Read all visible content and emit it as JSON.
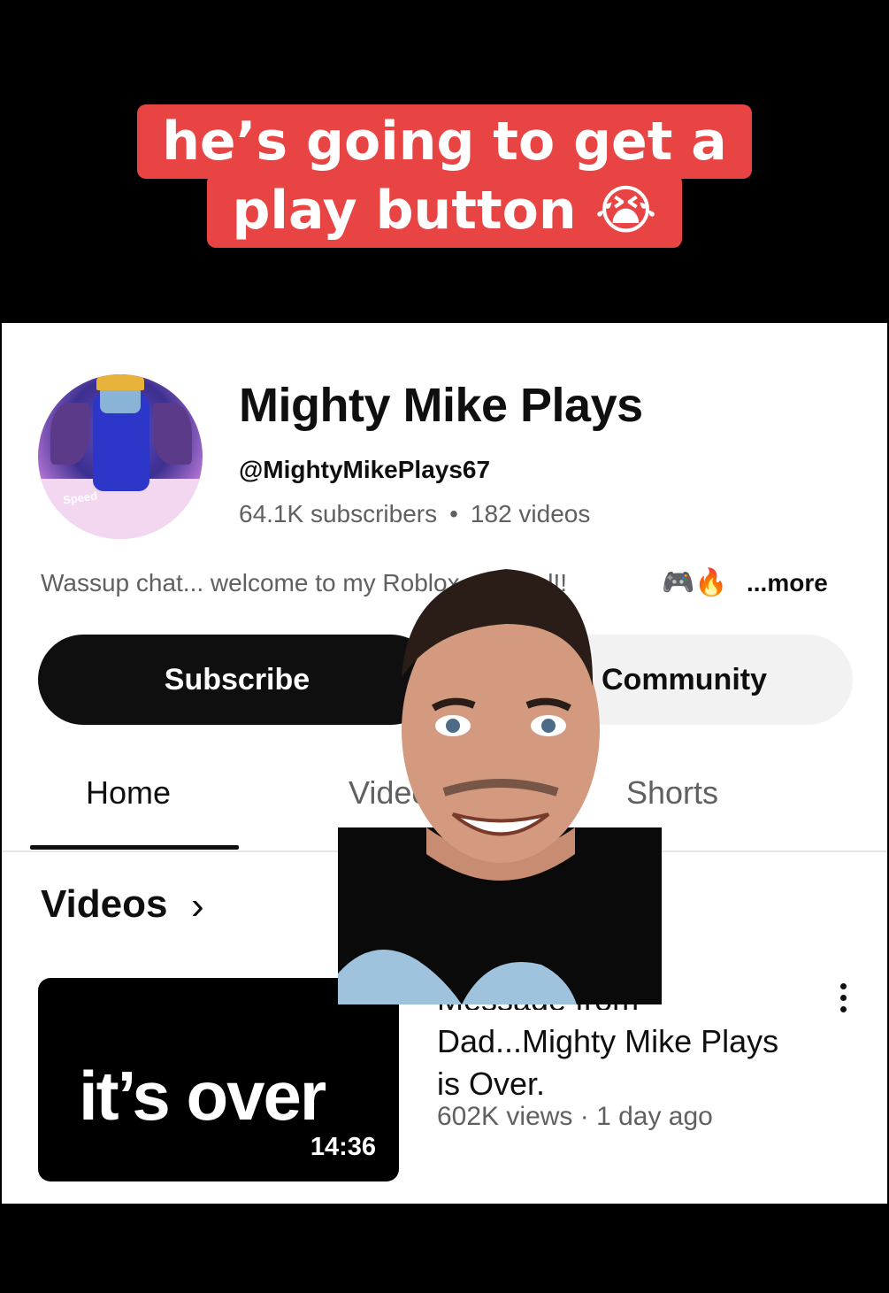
{
  "caption": {
    "line1": "he’s going to get a",
    "line2": "play button 😭"
  },
  "channel": {
    "name": "Mighty Mike Plays",
    "handle": "@MightyMikePlays67",
    "subscribers": "64.1K subscribers",
    "videos": "182 videos",
    "separator": "•",
    "description": "Wassup chat... welcome to my Roblox channel!!",
    "description_icons": "🎮🔥",
    "more_label": "...more",
    "avatar_text": "Speed"
  },
  "actions": {
    "subscribe_label": "Subscribe",
    "community_label": "Community"
  },
  "tabs": [
    {
      "label": "Home",
      "active": true
    },
    {
      "label": "Videos",
      "active": false
    },
    {
      "label": "Shorts",
      "active": false
    }
  ],
  "section": {
    "title": "Videos",
    "chevron": "›"
  },
  "video": {
    "thumbnail_text": "it’s over",
    "duration": "14:36",
    "title_line0": "Message from",
    "title": "Dad...Mighty Mike Plays is Over.",
    "meta": "602K views · 1 day ago"
  },
  "colors": {
    "caption_bg": "#e94444",
    "subscribe_bg": "#0f0f0f",
    "muted_text": "#606060"
  }
}
